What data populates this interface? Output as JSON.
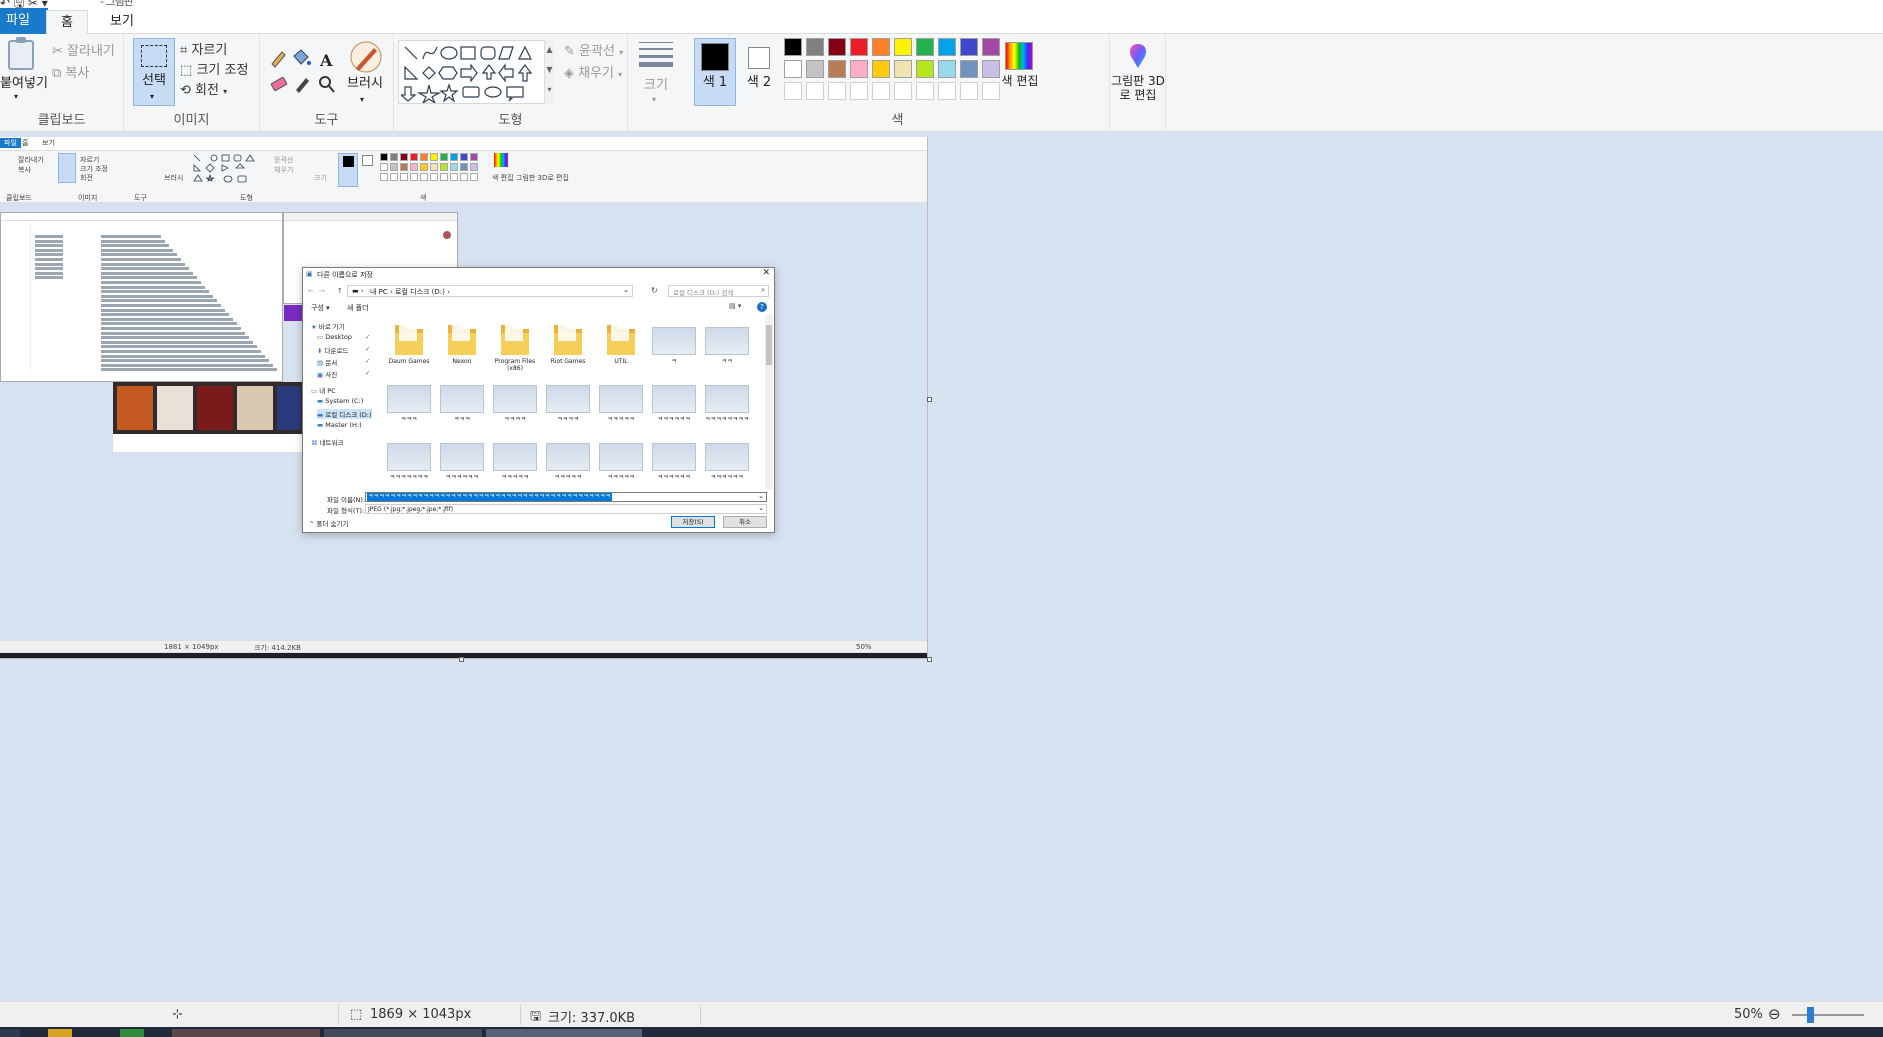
{
  "window": {
    "quick_access": "↶ 🖫 ✂ ▾",
    "title": "- 그림판"
  },
  "menu": {
    "file": "파일",
    "home": "홈",
    "view": "보기"
  },
  "ribbon": {
    "clipboard": {
      "paste": "붙여넣기",
      "cut": "잘라내기",
      "copy": "복사",
      "label": "클립보드"
    },
    "image": {
      "select": "선택",
      "crop": "자르기",
      "resize": "크기 조정",
      "rotate": "회전",
      "label": "이미지"
    },
    "tools": {
      "brush": "브러시",
      "label": "도구"
    },
    "shapes": {
      "outline": "윤곽선",
      "fill": "채우기",
      "label": "도형"
    },
    "size": {
      "label": "크기"
    },
    "colors": {
      "color1": "색 1",
      "color2": "색 2",
      "edit": "색 편집",
      "label": "색",
      "color1_value": "#000000",
      "color2_value": "#ffffff",
      "palette_row1": [
        "#000000",
        "#7f7f7f",
        "#880015",
        "#ed1c24",
        "#ff7f27",
        "#fff200",
        "#22b14c",
        "#00a2e8",
        "#3f48cc",
        "#a349a4"
      ],
      "palette_row2": [
        "#ffffff",
        "#c3c3c3",
        "#b97a57",
        "#ffaec9",
        "#ffc90e",
        "#efe4b0",
        "#b5e61d",
        "#99d9ea",
        "#7092be",
        "#c8bfe7"
      ]
    },
    "paint3d": "그림판 3D로 편집"
  },
  "dialog": {
    "title": "다른 이름으로 저장",
    "address": "내 PC  ›  로컬 디스크 (D:)  ›",
    "search_placeholder": "로컬 디스크 (D:) 검색",
    "organize": "구성 ▾",
    "new_folder": "새 폴더",
    "nav": [
      {
        "label": "바로 가기"
      },
      {
        "label": "Desktop"
      },
      {
        "label": "다운로드"
      },
      {
        "label": "문서"
      },
      {
        "label": "사진"
      },
      {
        "label": "내 PC"
      },
      {
        "label": "System (C:)"
      },
      {
        "label": "로컬 디스크 (D:)"
      },
      {
        "label": "Master (H:)"
      },
      {
        "label": "네트워크"
      }
    ],
    "folders": [
      "Daum Games",
      "Nexon",
      "Program Files (x86)",
      "Riot Games",
      "UTIL"
    ],
    "files_row1": [
      "ㅋ",
      "ㅋㅋ"
    ],
    "files_row2": [
      "ㅋㅋㅋ",
      "ㅋㅋㅋ",
      "ㅋㅋㅋㅋ",
      "ㅋㅋㅋㅋ",
      "ㅋㅋㅋㅋㅋ",
      "ㅋㅋㅋㅋㅋㅋ",
      "ㅋㅋㅋㅋㅋㅋㅋㅋ"
    ],
    "files_row3": [
      "ㅋㅋㅋㅋㅋㅋㅋ",
      "ㅋㅋㅋㅋㅋㅋ",
      "ㅋㅋㅋㅋㅋ",
      "ㅋㅋㅋㅋㅋ",
      "ㅋㅋㅋㅋㅋ",
      "ㅋㅋㅋㅋㅋㅋ",
      "ㅋㅋㅋㅋㅋㅋ"
    ],
    "filename_label": "파일 이름(N):",
    "filename_value": "ㅋㅋㅋㅋㅋㅋㅋㅋㅋㅋㅋㅋㅋㅋㅋㅋㅋㅋㅋㅋㅋㅋㅋㅋㅋㅋㅋㅋㅋㅋㅋㅋㅋㅋㅋㅋㅋㅋㅋㅋㅋㅋㅋㅋ",
    "filetype_label": "파일 형식(T):",
    "filetype_value": "JPEG (*.jpg;*.jpeg;*.jpe;*.jfif)",
    "hide_folders": "폴더 숨기기",
    "save": "저장(S)",
    "cancel": "취소"
  },
  "inner": {
    "size": "1881 × 1049px",
    "filesize": "크기: 414.2KB",
    "zoom": "50%"
  },
  "status": {
    "dimensions": "1869 × 1043px",
    "filesize": "크기: 337.0KB",
    "zoom": "50%",
    "zoom_level": 0.25
  }
}
